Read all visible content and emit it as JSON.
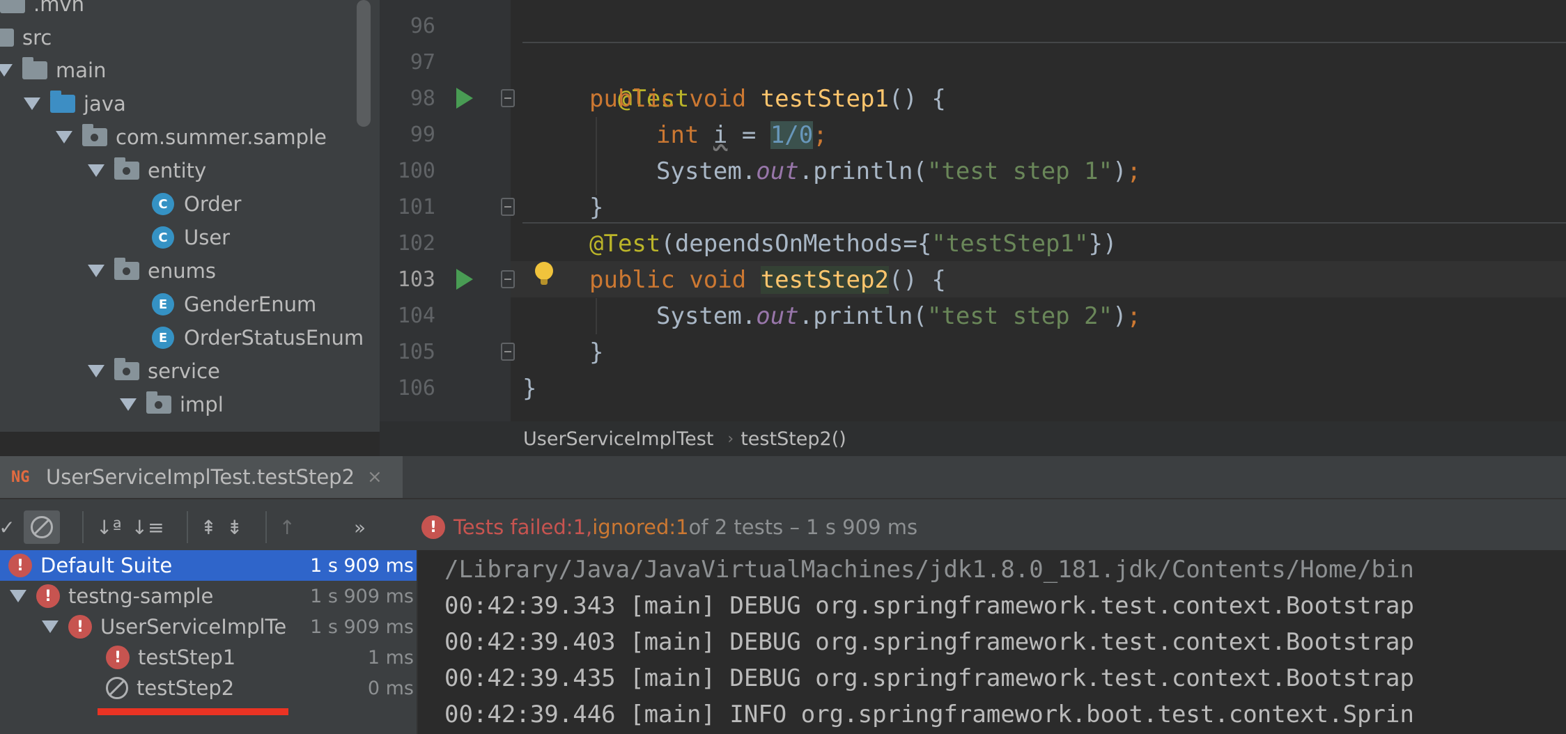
{
  "project_tree": {
    "items": [
      {
        "label": ".mvn",
        "type": "folder"
      },
      {
        "label": "src",
        "type": "folder"
      },
      {
        "label": "main",
        "type": "folder"
      },
      {
        "label": "java",
        "type": "source-folder"
      },
      {
        "label": "com.summer.sample",
        "type": "package"
      },
      {
        "label": "entity",
        "type": "package"
      },
      {
        "label": "Order",
        "type": "class",
        "badge": "C"
      },
      {
        "label": "User",
        "type": "class",
        "badge": "C"
      },
      {
        "label": "enums",
        "type": "package"
      },
      {
        "label": "GenderEnum",
        "type": "enum",
        "badge": "E"
      },
      {
        "label": "OrderStatusEnum",
        "type": "enum",
        "badge": "E"
      },
      {
        "label": "service",
        "type": "package"
      },
      {
        "label": "impl",
        "type": "package"
      }
    ]
  },
  "editor": {
    "line_numbers": [
      "96",
      "97",
      "98",
      "99",
      "100",
      "101",
      "102",
      "103",
      "104",
      "105",
      "106"
    ],
    "current_line": "103",
    "code": {
      "l97_annotation": "@Test",
      "l98_kw1": "public",
      "l98_kw2": "void",
      "l98_fn": "testStep1",
      "l98_rest": "() {",
      "l99_kw": "int",
      "l99_var": "i",
      "l99_eq": " = ",
      "l99_val": "1/0",
      "l99_semi": ";",
      "l100_sys": "System.",
      "l100_out": "out",
      "l100_call": ".println(",
      "l100_str": "\"test step 1\"",
      "l100_end": ")",
      "l100_semi": ";",
      "l101_brace": "}",
      "l102_annotation": "@Test",
      "l102_args_open": "(dependsOnMethods={",
      "l102_str": "\"testStep1\"",
      "l102_args_close": "})",
      "l103_kw1": "public",
      "l103_kw2": "void",
      "l103_fn": "testStep2",
      "l103_rest": "() {",
      "l104_sys": "System.",
      "l104_out": "out",
      "l104_call": ".println(",
      "l104_str": "\"test step 2\"",
      "l104_end": ")",
      "l104_semi": ";",
      "l105_brace": "}",
      "l106_brace": "}"
    }
  },
  "breadcrumb": {
    "class_name": "UserServiceImplTest",
    "separator": "›",
    "method_name": "testStep2()"
  },
  "run_window": {
    "tab_icon_text": "NG",
    "tab_label": "UserServiceImplTest.testStep2",
    "tab_close": "×",
    "toolbar": {
      "sort_alpha": "↓ª",
      "sort_duration": "↓≡",
      "expand_all": "⇞",
      "collapse_all": "⇟",
      "prev_failed": "↑",
      "more": "»"
    },
    "status": {
      "failed_label": "Tests failed: ",
      "failed_count": "1",
      "comma": ", ",
      "ignored_label": "ignored: ",
      "ignored_count": "1",
      "total_text": " of 2 tests – 1 s 909 ms"
    },
    "test_tree": [
      {
        "name": "Default Suite",
        "time": "1 s 909 ms",
        "status": "failed"
      },
      {
        "name": "testng-sample",
        "time": "1 s 909 ms",
        "status": "failed"
      },
      {
        "name": "UserServiceImplTe",
        "time": "1 s 909 ms",
        "status": "failed"
      },
      {
        "name": "testStep1",
        "time": "1 ms",
        "status": "failed"
      },
      {
        "name": "testStep2",
        "time": "0 ms",
        "status": "ignored"
      }
    ],
    "console_lines": [
      "/Library/Java/JavaVirtualMachines/jdk1.8.0_181.jdk/Contents/Home/bin",
      "00:42:39.343 [main] DEBUG org.springframework.test.context.Bootstrap",
      "00:42:39.403 [main] DEBUG org.springframework.test.context.Bootstrap",
      "00:42:39.435 [main] DEBUG org.springframework.test.context.Bootstrap",
      "00:42:39.446 [main] INFO org.springframework.boot.test.context.Sprin"
    ]
  },
  "colors": {
    "error": "#c75450",
    "ignored": "#cc7832",
    "selection": "#2f65ca",
    "highlight_underline": "#ea3323"
  }
}
